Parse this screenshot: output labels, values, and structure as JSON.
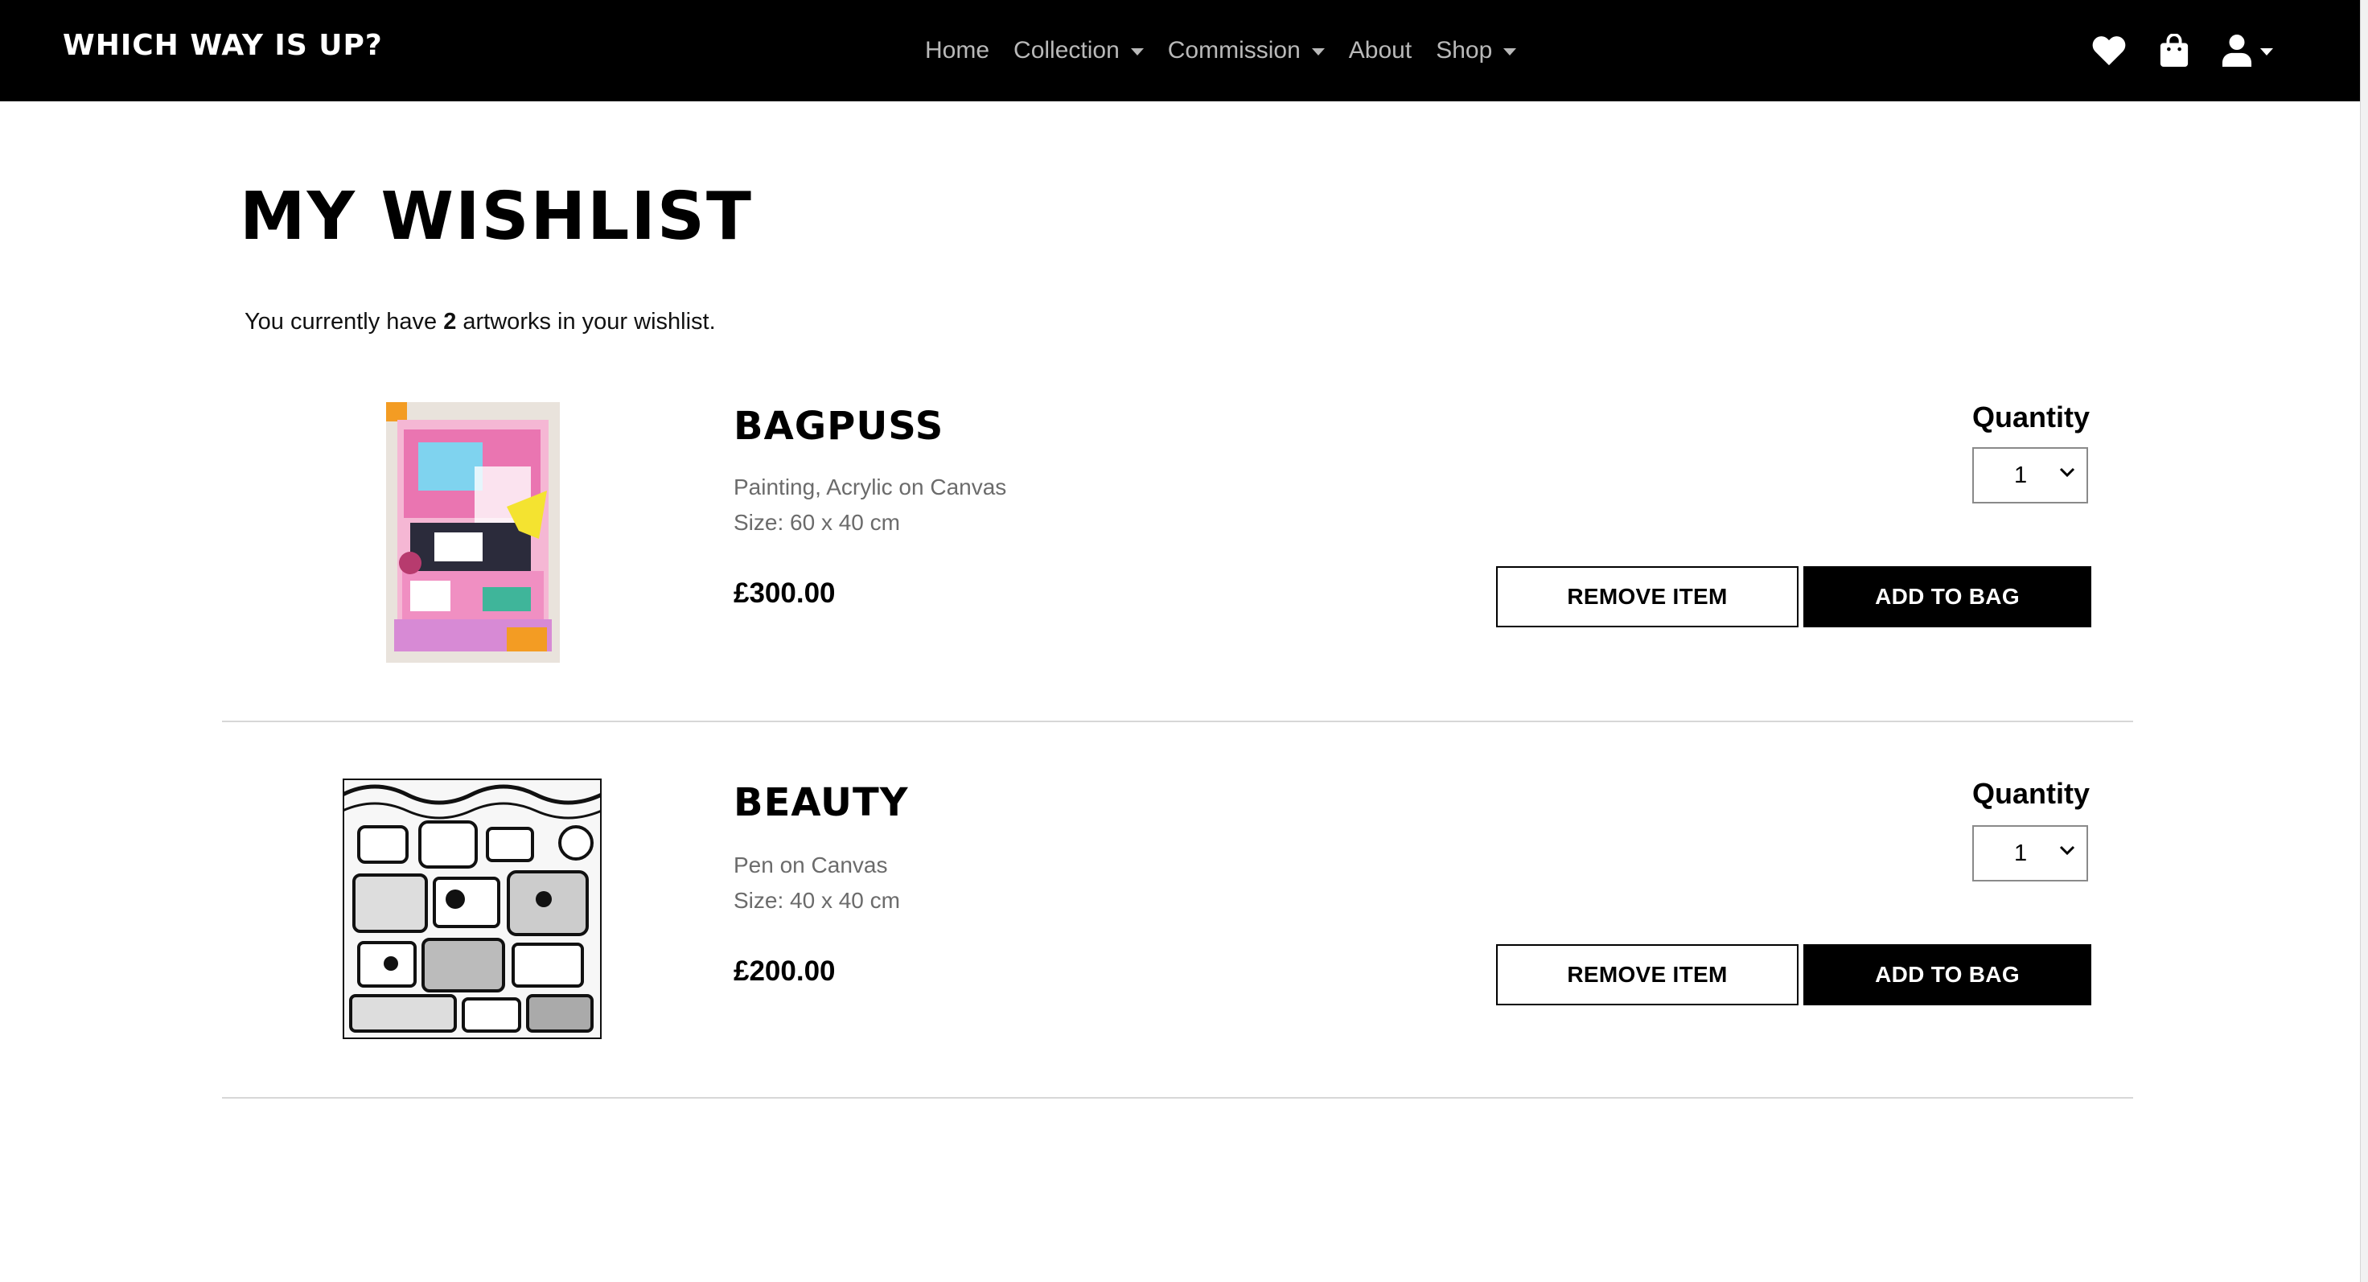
{
  "navbar": {
    "brand": "WHICH WAY IS UP?",
    "links": [
      {
        "label": "Home",
        "dropdown": false
      },
      {
        "label": "Collection",
        "dropdown": true
      },
      {
        "label": "Commission",
        "dropdown": true
      },
      {
        "label": "About",
        "dropdown": false
      },
      {
        "label": "Shop",
        "dropdown": true
      }
    ],
    "icons": [
      "heart-icon",
      "shopping-bag-icon",
      "user-icon"
    ]
  },
  "page": {
    "title": "MY WISHLIST",
    "summary_prefix": "You currently have ",
    "count": "2",
    "summary_suffix": " artworks in your wishlist."
  },
  "items": [
    {
      "title": "BAGPUSS",
      "type": "Painting, Acrylic on Canvas",
      "size": "Size: 60 x 40 cm",
      "price": "£300.00",
      "quantity_label": "Quantity",
      "quantity": "1",
      "remove_label": "REMOVE ITEM",
      "add_label": "ADD TO BAG"
    },
    {
      "title": "BEAUTY",
      "type": "Pen on Canvas",
      "size": "Size: 40 x 40 cm",
      "price": "£200.00",
      "quantity_label": "Quantity",
      "quantity": "1",
      "remove_label": "REMOVE ITEM",
      "add_label": "ADD TO BAG"
    }
  ],
  "colors": {
    "navbar_bg": "#000000",
    "nav_text": "#b9b9b9",
    "meta_text": "#6b6b6b",
    "divider": "#d7d7d7"
  }
}
